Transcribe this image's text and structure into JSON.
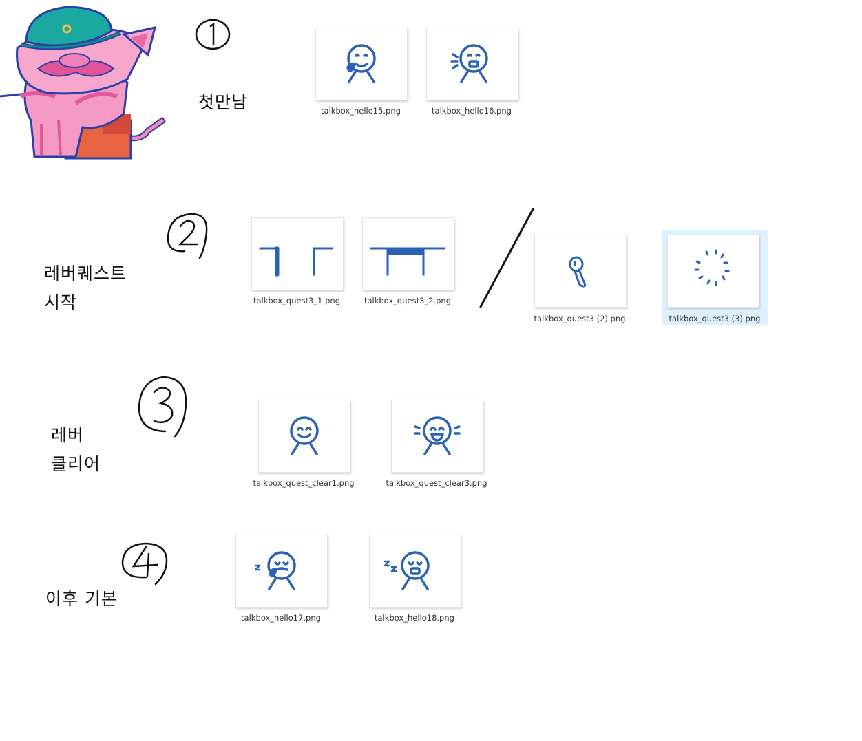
{
  "sections": [
    {
      "number": "1",
      "label_lines": [
        "첫만남"
      ]
    },
    {
      "number": "2",
      "label_lines": [
        "레버퀘스트",
        "시작"
      ]
    },
    {
      "number": "3",
      "label_lines": [
        "레버",
        "클리어"
      ]
    },
    {
      "number": "4",
      "label_lines": [
        "이후 기본"
      ]
    }
  ],
  "files": [
    "talkbox_hello15.png",
    "talkbox_hello16.png",
    "talkbox_quest3_1.png",
    "talkbox_quest3_2.png",
    "talkbox_quest3 (2).png",
    "talkbox_quest3 (3).png",
    "talkbox_quest_clear1.png",
    "talkbox_quest_clear3.png",
    "talkbox_hello17.png",
    "talkbox_hello18.png"
  ],
  "selected_file": "talkbox_quest3 (3).png",
  "colors": {
    "doodle_blue": "#2b62b6",
    "selection": "#dff0fd",
    "ink": "#111111"
  },
  "icons": [
    "pig-character-icon",
    "separator-slash"
  ]
}
